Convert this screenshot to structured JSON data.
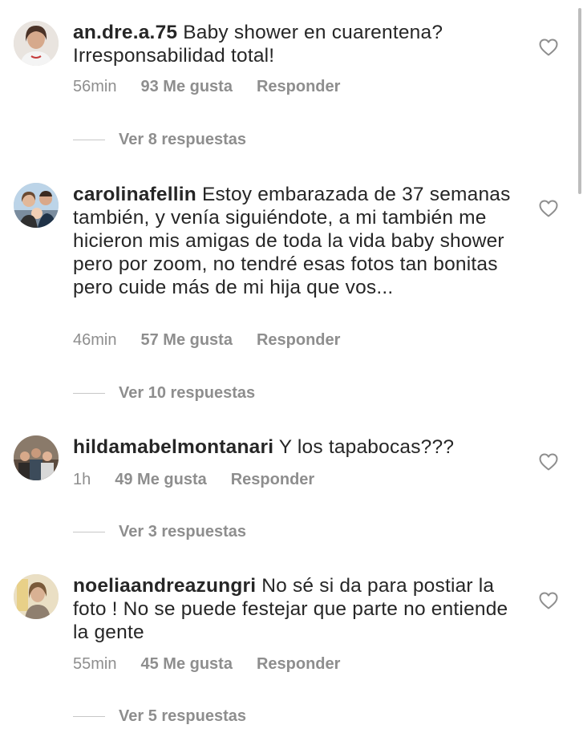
{
  "comments": [
    {
      "username": "an.dre.a.75",
      "text": " Baby shower en cuarentena? Irresponsabilidad total!",
      "time": "56min",
      "likes": "93 Me gusta",
      "reply": "Responder",
      "view_replies": "Ver 8 respuestas"
    },
    {
      "username": "carolinafellin",
      "text": " Estoy embarazada de 37 semanas también, y venía siguiéndote, a mi también me hicieron mis amigas de toda la vida baby shower pero por zoom, no tendré esas fotos tan bonitas pero cuide más de mi hija que vos...",
      "time": "46min",
      "likes": "57 Me gusta",
      "reply": "Responder",
      "view_replies": "Ver 10 respuestas"
    },
    {
      "username": "hildamabelmontanari",
      "text": " Y los tapabocas???",
      "time": "1h",
      "likes": "49 Me gusta",
      "reply": "Responder",
      "view_replies": "Ver 3 respuestas"
    },
    {
      "username": "noeliaandreazungri",
      "text": " No sé si da para postiar la foto ! No se puede festejar que parte no entiende la gente",
      "time": "55min",
      "likes": "45 Me gusta",
      "reply": "Responder",
      "view_replies": "Ver 5 respuestas"
    }
  ],
  "icons": {
    "like": "heart-outline-icon"
  },
  "colors": {
    "text": "#262626",
    "muted": "#8e8e8e",
    "divider": "#c7c7c7"
  }
}
